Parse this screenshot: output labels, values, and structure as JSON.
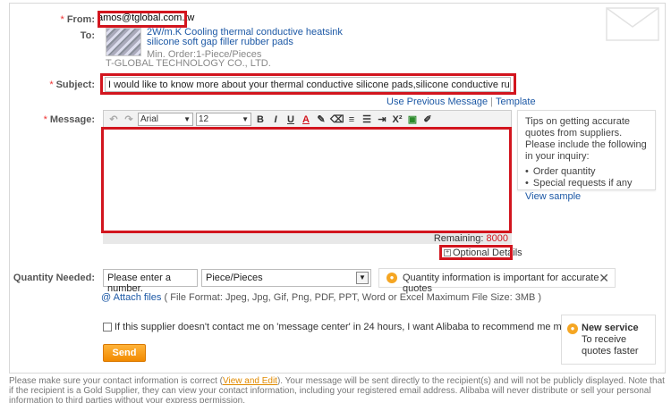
{
  "form": {
    "from_label": "From:",
    "to_label": "To:",
    "subject_label": "Subject:",
    "message_label": "Message:",
    "quantity_label": "Quantity Needed:",
    "required_mark": "*"
  },
  "from_value": "amos@tglobal.com.tw",
  "recipient": {
    "product_title_line1": "2W/m.K Cooling thermal conductive heatsink",
    "product_title_line2": "silicone soft gap filler rubber pads",
    "min_order": "Min. Order:1-Piece/Pieces",
    "company": "T-GLOBAL TECHNOLOGY CO., LTD."
  },
  "subject_value": "I would like to know more about your thermal conductive silicone pads,silicone conductive rubber pads,thermal gap",
  "subject_links": {
    "use_previous": "Use Previous Message",
    "separator": "|",
    "template": "Template"
  },
  "toolbar": {
    "font_name": "Arial",
    "font_size": "12",
    "bold": "B",
    "italic": "I",
    "underline": "U",
    "text_color": "A",
    "superscript": "X²"
  },
  "remaining": {
    "label": "Remaining:",
    "count": "8000"
  },
  "optional_details": {
    "toggle": "+",
    "label": "Optional Details"
  },
  "tips": {
    "intro": "Tips on getting accurate quotes from suppliers. Please include the following in your inquiry:",
    "items": [
      "Order quantity",
      "Special requests if any"
    ],
    "view_sample": "View sample"
  },
  "quantity": {
    "placeholder": "Please enter a number.",
    "unit": "Piece/Pieces",
    "tip": "Quantity information is important for accurate quotes"
  },
  "attach": {
    "link": "Attach files",
    "note": "( File Format: Jpeg, Jpg, Gif, Png, PDF, PPT, Word or Excel Maximum File Size: 3MB )"
  },
  "recommend": {
    "text": "If this supplier doesn't contact me on 'message center' in 24 hours, I want Alibaba to recommend me more selected supplier."
  },
  "send_label": "Send",
  "new_service": {
    "title": "New service",
    "body": "To receive quotes faster"
  },
  "footer": {
    "part1": "Please make sure your contact information is correct (",
    "link": "View and Edit",
    "part2": "). Your message will be sent directly to the recipient(s) and will not be publicly displayed. Note that if the recipient is a Gold Supplier, they can view your contact information, including your registered email address. Alibaba will never distribute or sell your personal information to third parties without your express permission."
  },
  "colors": {
    "highlight_red": "#d2151e",
    "link_blue": "#1c58a5",
    "send_orange": "#f28a00"
  }
}
